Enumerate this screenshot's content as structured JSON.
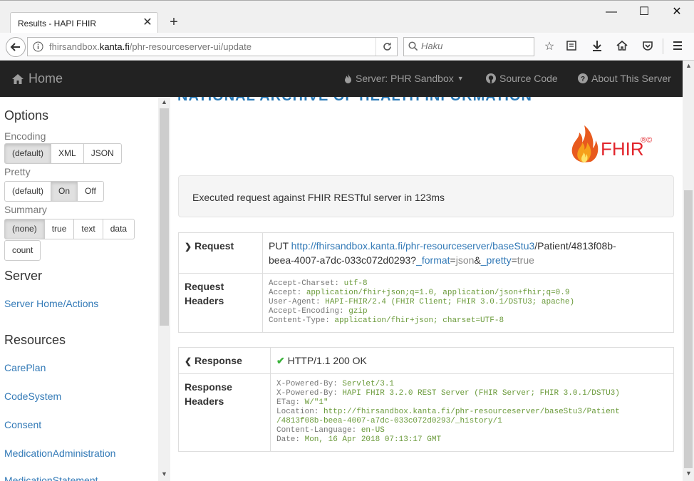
{
  "browser": {
    "tab_title": "Results - HAPI FHIR",
    "url_prefix": "fhirsandbox.",
    "url_host": "kanta.fi",
    "url_path": "/phr-resourceserver-ui/update",
    "search_placeholder": "Haku"
  },
  "appnav": {
    "home": "Home",
    "server": "Server: PHR Sandbox",
    "source": "Source Code",
    "about": "About This Server"
  },
  "sidebar": {
    "options_title": "Options",
    "encoding_label": "Encoding",
    "encoding": [
      "(default)",
      "XML",
      "JSON"
    ],
    "pretty_label": "Pretty",
    "pretty": [
      "(default)",
      "On",
      "Off"
    ],
    "summary_label": "Summary",
    "summary": [
      "(none)",
      "true",
      "text",
      "data"
    ],
    "summary_count": "count",
    "server_title": "Server",
    "server_link": "Server Home/Actions",
    "resources_title": "Resources",
    "resources": [
      "CarePlan",
      "CodeSystem",
      "Consent",
      "MedicationAdministration",
      "MedicationStatement"
    ]
  },
  "main": {
    "cut_title": "NATIONAL ARCHIVE OF HEALTH INFORMATION",
    "logo_text": "FHIR",
    "logo_marks": "®©",
    "executed": "Executed request against FHIR RESTful server in 123ms",
    "request": {
      "label": "Request",
      "method": "PUT",
      "base": "http://fhirsandbox.kanta.fi/phr-resourceserver/baseStu3",
      "path1": "/Patient/4813f08b-",
      "path2": "beea-4007-a7dc-033c072d0293?",
      "p1k": "_format",
      "p1v": "json",
      "p2k": "_pretty",
      "p2v": "true",
      "headers_label1": "Request",
      "headers_label2": "Headers",
      "headers": [
        {
          "k": "Accept-Charset: ",
          "v": "utf-8"
        },
        {
          "k": "Accept: ",
          "v": "application/fhir+json;q=1.0, application/json+fhir;q=0.9"
        },
        {
          "k": "User-Agent: ",
          "v": "HAPI-FHIR/2.4 (FHIR Client; FHIR 3.0.1/DSTU3; apache)"
        },
        {
          "k": "Accept-Encoding: ",
          "v": "gzip"
        },
        {
          "k": "Content-Type: ",
          "v": "application/fhir+json; charset=UTF-8"
        }
      ]
    },
    "response": {
      "label": "Response",
      "status": "HTTP/1.1 200 OK",
      "headers_label1": "Response",
      "headers_label2": "Headers",
      "headers": [
        {
          "k": "X-Powered-By: ",
          "v": "Servlet/3.1"
        },
        {
          "k": "X-Powered-By: ",
          "v": "HAPI FHIR 3.2.0 REST Server (FHIR Server; FHIR 3.0.1/DSTU3)"
        },
        {
          "k": "ETag: ",
          "v": "W/\"1\""
        },
        {
          "k": "Location: ",
          "v": "http://fhirsandbox.kanta.fi/phr-resourceserver/baseStu3/Patient"
        },
        {
          "k": "",
          "v": "/4813f08b-beea-4007-a7dc-033c072d0293/_history/1"
        },
        {
          "k": "Content-Language: ",
          "v": "en-US"
        },
        {
          "k": "Date: ",
          "v": "Mon, 16 Apr 2018 07:13:17 GMT"
        }
      ]
    }
  }
}
